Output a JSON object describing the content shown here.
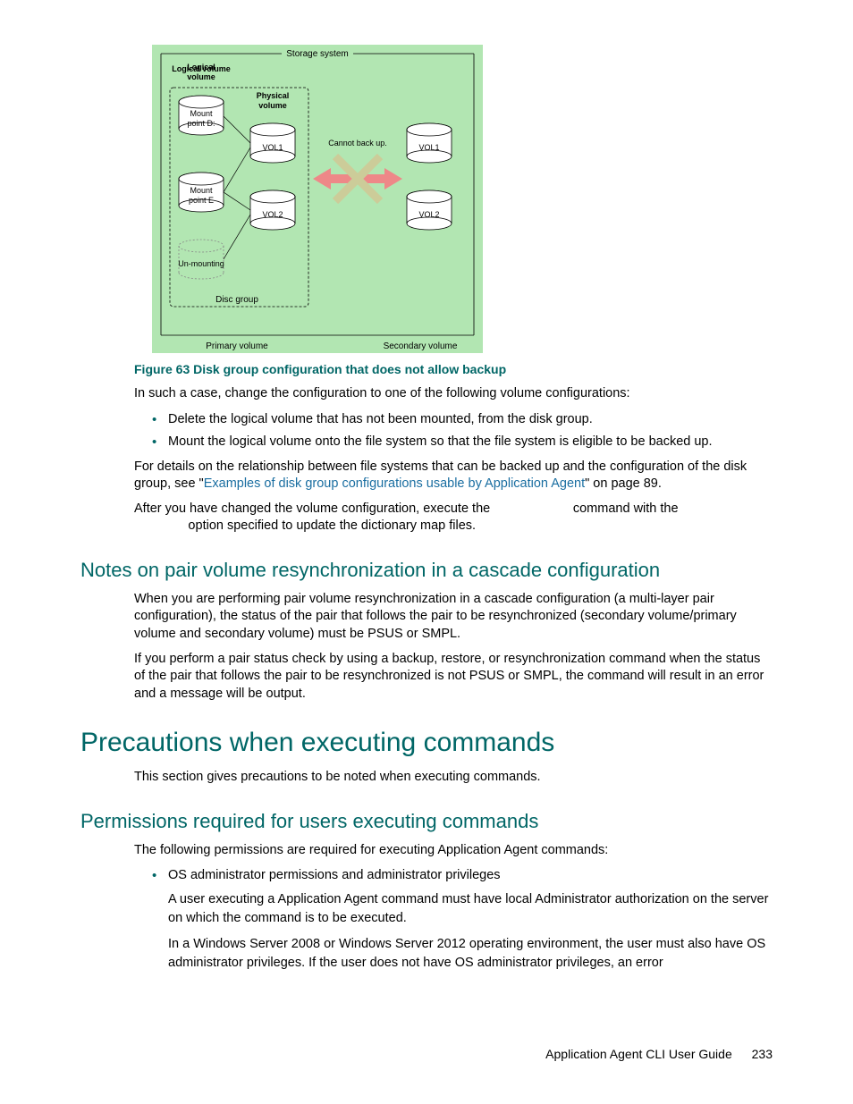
{
  "diagram": {
    "title": "Storage system",
    "logical_volume_label": "Logical volume",
    "physical_volume_label": "Physical volume",
    "mount_d": "Mount point D:",
    "mount_e": "Mount point E",
    "unmounting": "Un-mounting",
    "disc_group": "Disc group",
    "vol1": "VOL1",
    "vol2": "VOL2",
    "cannot": "Cannot back up.",
    "primary": "Primary volume",
    "secondary": "Secondary volume"
  },
  "figure_caption": "Figure 63 Disk group configuration that does not allow backup",
  "para1": "In such a case, change the configuration to one of the following volume configurations:",
  "bullets1": [
    "Delete the logical volume that has not been mounted, from the disk group.",
    "Mount the logical volume onto the file system so that the file system is eligible to be backed up."
  ],
  "para2_a": "For details on the relationship between file systems that can be backed up and the configuration of the disk group, see \"",
  "para2_link": "Examples of disk group configurations usable by Application Agent",
  "para2_b": "\" on page 89.",
  "para3_a": "After you have changed the volume configuration, execute the ",
  "para3_b": " command with the ",
  "para3_c": " option specified to update the dictionary map files.",
  "h2_notes": "Notes on pair volume resynchronization in a cascade configuration",
  "notes_p1": "When you are performing pair volume resynchronization in a cascade configuration (a multi-layer pair configuration), the status of the pair that follows the pair to be resynchronized (secondary volume/primary volume and secondary volume) must be PSUS or SMPL.",
  "notes_p2": "If you perform a pair status check by using a backup, restore, or resynchronization command when the status of the pair that follows the pair to be resynchronized is not PSUS or SMPL, the command will result in an error and a message will be output.",
  "h1_prec": "Precautions when executing commands",
  "prec_intro": "This section gives precautions to be noted when executing commands.",
  "h2_perms": "Permissions required for users executing commands",
  "perms_intro": "The following permissions are required for executing Application Agent commands:",
  "perms_b1": "OS administrator permissions and administrator privileges",
  "perms_p1": "A user executing a Application Agent command must have local Administrator authorization on the server on which the command is to be executed.",
  "perms_p2": "In a Windows Server 2008 or Windows Server 2012 operating environment, the user must also have OS administrator privileges. If the user does not have OS administrator privileges, an error",
  "footer_title": "Application Agent CLI User Guide",
  "footer_page": "233"
}
